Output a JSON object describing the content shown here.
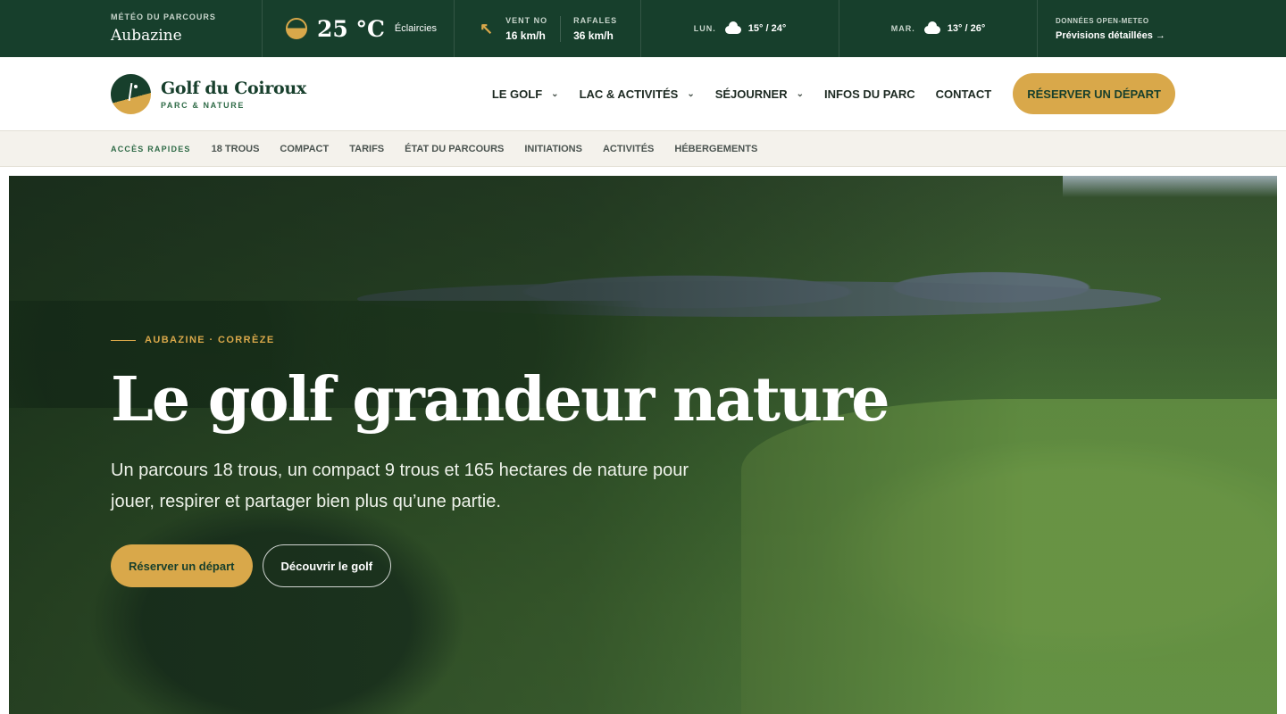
{
  "weather": {
    "location_label": "MÉTÉO DU PARCOURS",
    "location": "Aubazine",
    "temperature": "25 °C",
    "condition": "Éclaircies",
    "wind_label": "VENT NO",
    "wind_value": "16 km/h",
    "gusts_label": "RAFALES",
    "gusts_value": "36 km/h",
    "forecast": [
      {
        "day": "LUN.",
        "range": "15° / 24°"
      },
      {
        "day": "MAR.",
        "range": "13° / 26°"
      }
    ],
    "source_label": "DONNÉES OPEN-METEO",
    "source_link": "Prévisions détaillées →"
  },
  "brand": {
    "name": "Golf du Coiroux",
    "tagline": "PARC & NATURE"
  },
  "nav": {
    "items": [
      {
        "label": "LE GOLF",
        "dropdown": true
      },
      {
        "label": "LAC & ACTIVITÉS",
        "dropdown": true
      },
      {
        "label": "SÉJOURNER",
        "dropdown": true
      },
      {
        "label": "INFOS DU PARC",
        "dropdown": false
      },
      {
        "label": "CONTACT",
        "dropdown": false
      }
    ],
    "cta": "RÉSERVER UN DÉPART"
  },
  "quick": {
    "label": "ACCÈS RAPIDES",
    "items": [
      "18 TROUS",
      "COMPACT",
      "TARIFS",
      "ÉTAT DU PARCOURS",
      "INITIATIONS",
      "ACTIVITÉS",
      "HÉBERGEMENTS"
    ]
  },
  "hero": {
    "eyebrow": "AUBAZINE · CORRÈZE",
    "title": "Le golf grandeur nature",
    "subtitle": "Un parcours 18 trous, un compact 9 trous et 165 hectares de nature pour jouer, respirer et partager bien plus qu’une partie.",
    "primary_button": "Réserver un départ",
    "secondary_button": "Découvrir le golf"
  },
  "colors": {
    "forest": "#173f2c",
    "gold": "#d9a84a",
    "cream": "#f4f2ec"
  }
}
